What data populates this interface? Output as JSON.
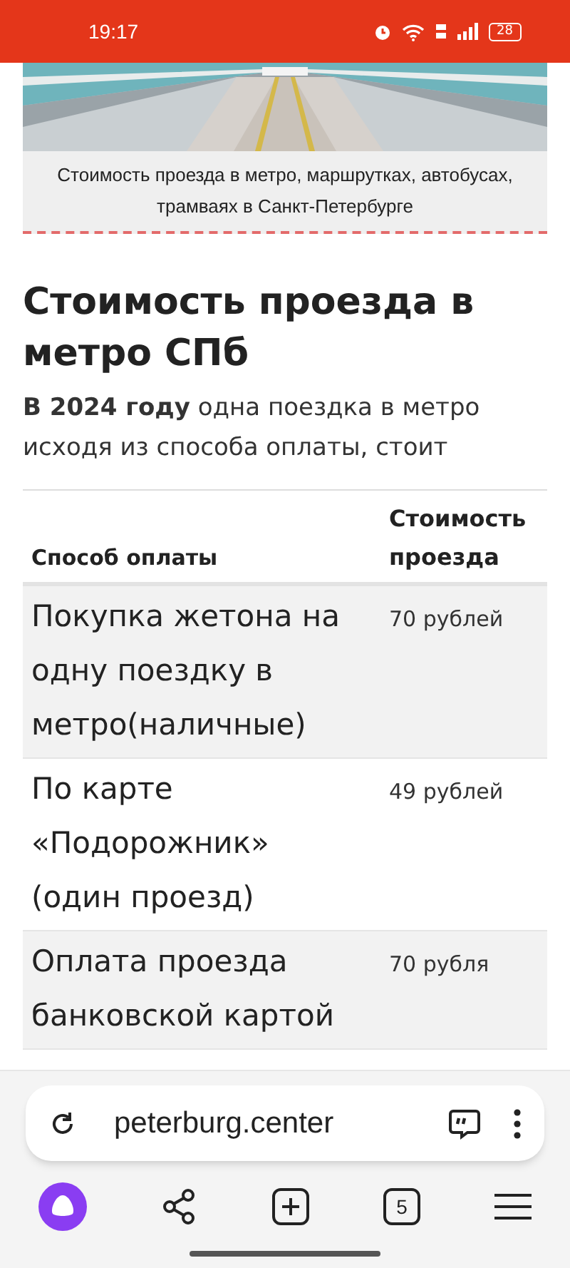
{
  "status_bar": {
    "time": "19:17",
    "battery": "28"
  },
  "article": {
    "caption": "Стоимость проезда в метро, маршрутках, автобусах, трамваях в Санкт-Петербурге",
    "heading": "Стоимость проезда в метро СПб",
    "intro": "**В 2024 году** одна поездка в метро исходя из способа оплаты, стоит",
    "table": {
      "columns": [
        "Способ оплаты",
        "Стоимость проезда"
      ],
      "rows": [
        {
          "method": "Покупка жетона на одну поездку в метро(наличные)",
          "price": "70 рублей"
        },
        {
          "method": "По карте «Подорожник» (один проезд)",
          "price": "49 рублей"
        },
        {
          "method": "Оплата проезда банковской картой",
          "price": "70 рубля"
        }
      ]
    }
  },
  "browser": {
    "url": "peterburg.center",
    "tab_count": "5"
  }
}
